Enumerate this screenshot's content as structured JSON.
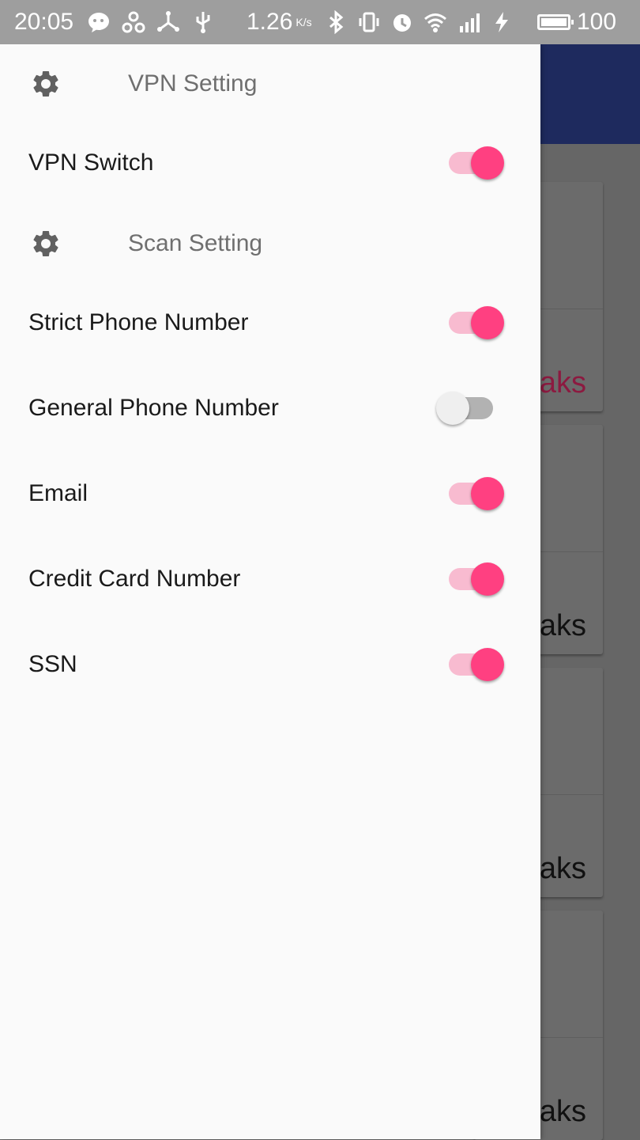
{
  "status_bar": {
    "time": "20:05",
    "net_speed": "1.26",
    "net_speed_unit": "K/s",
    "battery": "100",
    "icons": [
      "wechat-icon",
      "connection-icon",
      "share-icon",
      "usb-icon",
      "bluetooth-icon",
      "vibrate-icon",
      "alarm-icon",
      "wifi-icon",
      "signal-3g-icon",
      "charging-icon",
      "battery-icon"
    ]
  },
  "drawer": {
    "sections": [
      {
        "title": "VPN Setting",
        "icon": "gear-icon",
        "items": [
          {
            "label": "VPN Switch",
            "enabled": true
          }
        ]
      },
      {
        "title": "Scan Setting",
        "icon": "gear-icon",
        "items": [
          {
            "label": "Strict Phone Number",
            "enabled": true
          },
          {
            "label": "General Phone Number",
            "enabled": false
          },
          {
            "label": "Email",
            "enabled": true
          },
          {
            "label": "Credit Card Number",
            "enabled": true
          },
          {
            "label": "SSN",
            "enabled": true
          }
        ]
      }
    ]
  },
  "background": {
    "cards": [
      {
        "text": "aks",
        "accent": true
      },
      {
        "text": "aks",
        "accent": false
      },
      {
        "text": "aks",
        "accent": false
      },
      {
        "text": "aks",
        "accent": false
      }
    ]
  },
  "colors": {
    "accent": "#ff4081",
    "accent_track": "#f8bbd0",
    "toolbar": "#1e2a5e",
    "status_bar": "#9e9e9e"
  }
}
